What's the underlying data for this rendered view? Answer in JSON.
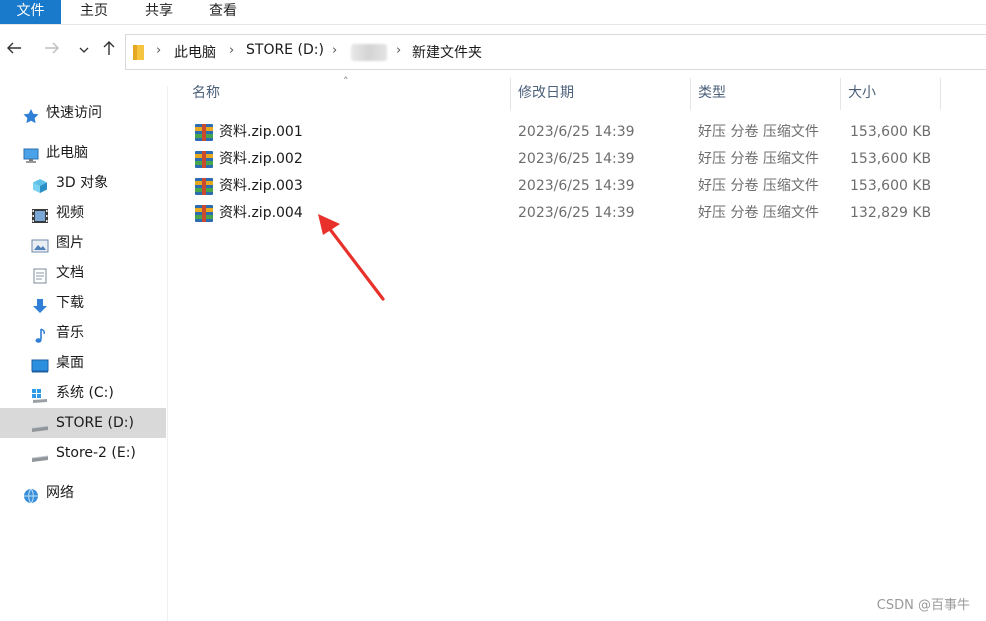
{
  "ribbon": {
    "tabs": [
      "文件",
      "主页",
      "共享",
      "查看"
    ]
  },
  "address": {
    "crumbs": [
      "此电脑",
      "STORE (D:)",
      "新建文件夹"
    ]
  },
  "sidebar": {
    "items": [
      {
        "label": "快速访问",
        "icon": "star-icon"
      },
      {
        "label": "此电脑",
        "icon": "computer-icon"
      },
      {
        "label": "3D 对象",
        "icon": "cube-icon"
      },
      {
        "label": "视频",
        "icon": "film-icon"
      },
      {
        "label": "图片",
        "icon": "picture-icon"
      },
      {
        "label": "文档",
        "icon": "document-icon"
      },
      {
        "label": "下载",
        "icon": "download-icon"
      },
      {
        "label": "音乐",
        "icon": "music-icon"
      },
      {
        "label": "桌面",
        "icon": "desktop-icon"
      },
      {
        "label": "系统 (C:)",
        "icon": "windows-drive-icon"
      },
      {
        "label": "STORE (D:)",
        "icon": "drive-icon"
      },
      {
        "label": "Store-2 (E:)",
        "icon": "drive-icon"
      },
      {
        "label": "网络",
        "icon": "network-icon"
      }
    ],
    "selected": "STORE (D:)"
  },
  "columns": {
    "name": "名称",
    "date": "修改日期",
    "type": "类型",
    "size": "大小"
  },
  "files": [
    {
      "name": "资料.zip.001",
      "date": "2023/6/25 14:39",
      "type": "好压 分卷 压缩文件",
      "size": "153,600 KB"
    },
    {
      "name": "资料.zip.002",
      "date": "2023/6/25 14:39",
      "type": "好压 分卷 压缩文件",
      "size": "153,600 KB"
    },
    {
      "name": "资料.zip.003",
      "date": "2023/6/25 14:39",
      "type": "好压 分卷 压缩文件",
      "size": "153,600 KB"
    },
    {
      "name": "资料.zip.004",
      "date": "2023/6/25 14:39",
      "type": "好压 分卷 压缩文件",
      "size": "132,829 KB"
    }
  ],
  "watermark": "CSDN @百事牛",
  "colors": {
    "accent": "#1979ca",
    "selected": "#d9d9d9",
    "annotation_arrow": "#e8312a"
  }
}
